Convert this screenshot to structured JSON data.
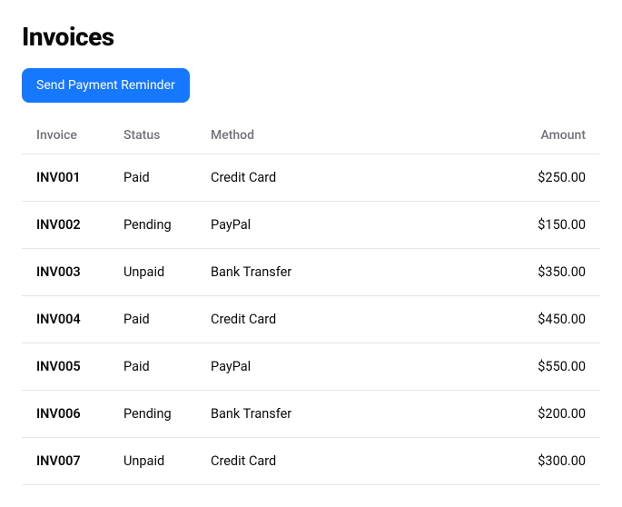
{
  "title": "Invoices",
  "button_label": "Send Payment Reminder",
  "columns": {
    "invoice": "Invoice",
    "status": "Status",
    "method": "Method",
    "amount": "Amount"
  },
  "rows": [
    {
      "invoice": "INV001",
      "status": "Paid",
      "method": "Credit Card",
      "amount": "$250.00"
    },
    {
      "invoice": "INV002",
      "status": "Pending",
      "method": "PayPal",
      "amount": "$150.00"
    },
    {
      "invoice": "INV003",
      "status": "Unpaid",
      "method": "Bank Transfer",
      "amount": "$350.00"
    },
    {
      "invoice": "INV004",
      "status": "Paid",
      "method": "Credit Card",
      "amount": "$450.00"
    },
    {
      "invoice": "INV005",
      "status": "Paid",
      "method": "PayPal",
      "amount": "$550.00"
    },
    {
      "invoice": "INV006",
      "status": "Pending",
      "method": "Bank Transfer",
      "amount": "$200.00"
    },
    {
      "invoice": "INV007",
      "status": "Unpaid",
      "method": "Credit Card",
      "amount": "$300.00"
    }
  ]
}
